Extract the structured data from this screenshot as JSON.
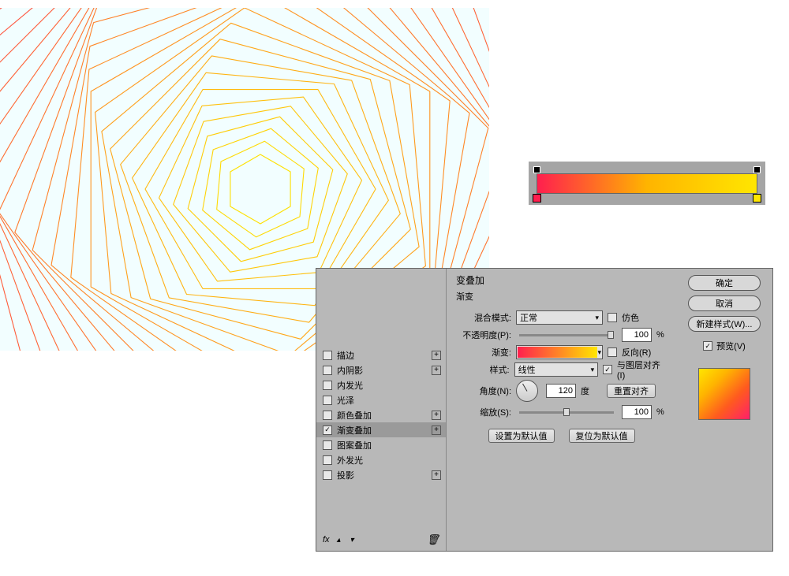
{
  "artwork": {
    "bg_color": "#f2feff",
    "gradient_from": "#ffe600",
    "gradient_to": "#ff1f4e"
  },
  "gradient_editor": {
    "stops": {
      "start_color": "#ff1f4e",
      "end_color": "#ffe600"
    }
  },
  "layer_style": {
    "effects": [
      {
        "label": "描边",
        "checked": false,
        "plus": true,
        "selected": false
      },
      {
        "label": "内阴影",
        "checked": false,
        "plus": true,
        "selected": false
      },
      {
        "label": "内发光",
        "checked": false,
        "plus": false,
        "selected": false
      },
      {
        "label": "光泽",
        "checked": false,
        "plus": false,
        "selected": false
      },
      {
        "label": "颜色叠加",
        "checked": false,
        "plus": true,
        "selected": false
      },
      {
        "label": "渐变叠加",
        "checked": true,
        "plus": true,
        "selected": true
      },
      {
        "label": "图案叠加",
        "checked": false,
        "plus": false,
        "selected": false
      },
      {
        "label": "外发光",
        "checked": false,
        "plus": false,
        "selected": false
      },
      {
        "label": "投影",
        "checked": false,
        "plus": true,
        "selected": false
      }
    ],
    "footer_label": "fx",
    "section_title": "变叠加",
    "section_sub": "渐变",
    "blend_mode": {
      "label": "混合模式:",
      "value": "正常",
      "dither_label": "仿色",
      "dither": false
    },
    "opacity": {
      "label": "不透明度(P):",
      "value": "100",
      "unit": "%"
    },
    "gradient": {
      "label": "渐变:",
      "reverse_label": "反向(R)",
      "reverse": false
    },
    "style": {
      "label": "样式:",
      "value": "线性",
      "align_label": "与图层对齐(I)",
      "align": true
    },
    "angle": {
      "label": "角度(N):",
      "value": "120",
      "unit": "度",
      "reset_label": "重置对齐"
    },
    "scale": {
      "label": "缩放(S):",
      "value": "100",
      "unit": "%"
    },
    "defaults": {
      "make": "设置为默认值",
      "reset": "复位为默认值"
    },
    "buttons": {
      "ok": "确定",
      "cancel": "取消",
      "new_style": "新建样式(W)..."
    },
    "preview": {
      "label": "预览(V)",
      "checked": true
    }
  }
}
